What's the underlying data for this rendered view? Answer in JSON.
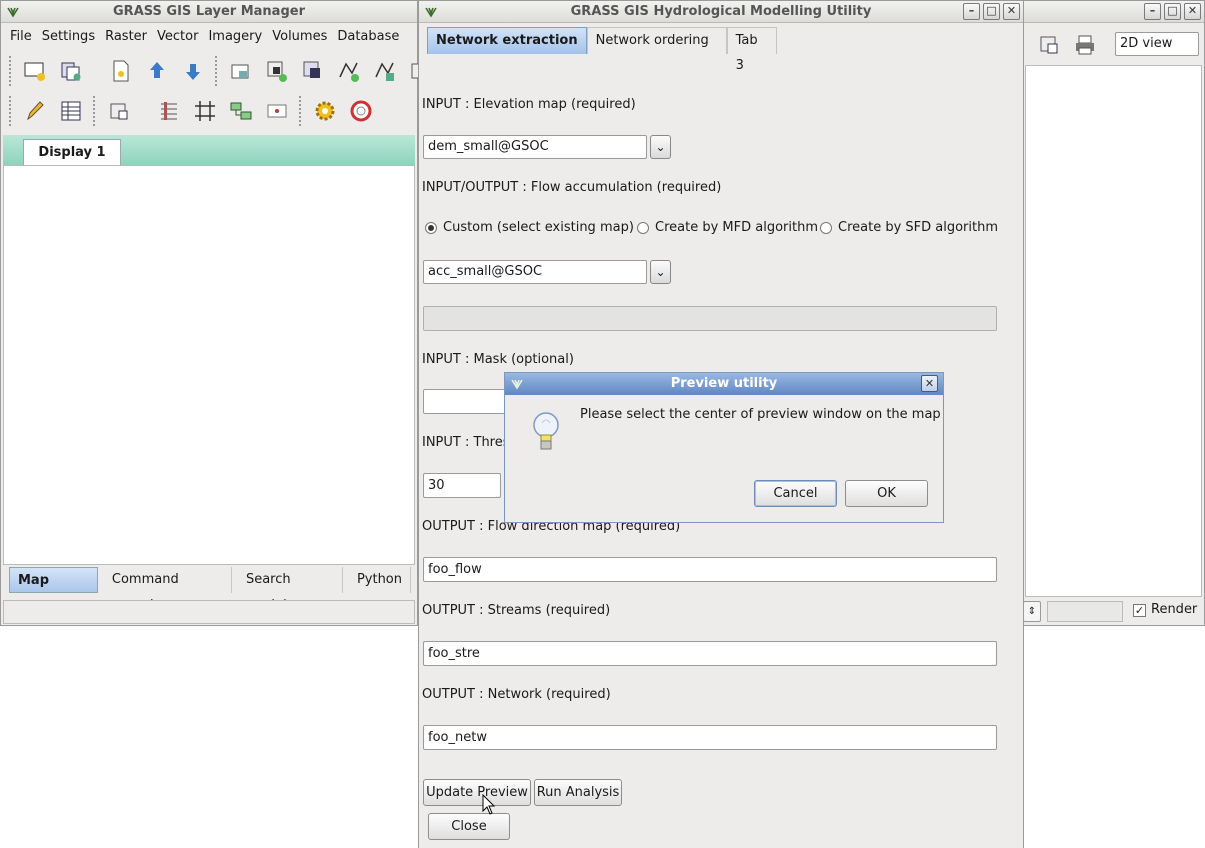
{
  "layer_manager": {
    "title": "GRASS GIS Layer Manager",
    "menu": [
      "File",
      "Settings",
      "Raster",
      "Vector",
      "Imagery",
      "Volumes",
      "Database"
    ],
    "display_tab": "Display 1",
    "bottom_tabs": [
      "Map layers",
      "Command console",
      "Search module",
      "Python"
    ]
  },
  "hydro_window": {
    "title": "GRASS GIS Hydrological Modelling Utility",
    "tabs": [
      "Network extraction",
      "Network ordering",
      "Tab 3"
    ],
    "elevation_label": "INPUT : Elevation map (required)",
    "elevation_value": "dem_small@GSOC",
    "flow_acc_label": "INPUT/OUTPUT : Flow accumulation (required)",
    "radio_custom": "Custom (select existing map)",
    "radio_mfd": "Create by MFD algorithm",
    "radio_sfd": "Create by SFD algorithm",
    "flow_acc_value": "acc_small@GSOC",
    "mask_label": "INPUT : Mask (optional)",
    "mask_value": "",
    "threshold_label": "INPUT : Thres",
    "threshold_value": "30",
    "flow_dir_label": "OUTPUT : Flow direction map (required)",
    "flow_dir_value": "foo_flow",
    "streams_label": "OUTPUT : Streams (required)",
    "streams_value": "foo_stre",
    "network_label": "OUTPUT : Network (required)",
    "network_value": "foo_netw",
    "update_preview": "Update Preview",
    "run_analysis": "Run Analysis",
    "close": "Close"
  },
  "map_display": {
    "view_select": "2D view",
    "render_label": "Render"
  },
  "dialog": {
    "title": "Preview utility",
    "message": "Please select the center of preview window on the map",
    "cancel": "Cancel",
    "ok": "OK"
  }
}
